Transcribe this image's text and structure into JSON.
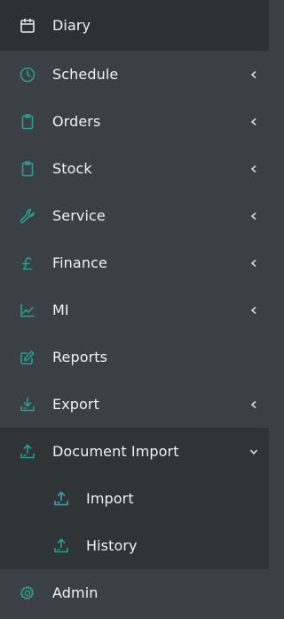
{
  "sidebar": {
    "items": [
      {
        "label": "Diary",
        "icon": "calendar-icon",
        "caret": "none"
      },
      {
        "label": "Schedule",
        "icon": "clock-icon",
        "caret": "left"
      },
      {
        "label": "Orders",
        "icon": "clipboard-icon",
        "caret": "left"
      },
      {
        "label": "Stock",
        "icon": "clipboard-icon",
        "caret": "left"
      },
      {
        "label": "Service",
        "icon": "wrench-icon",
        "caret": "left"
      },
      {
        "label": "Finance",
        "icon": "pound-icon",
        "caret": "left"
      },
      {
        "label": "MI",
        "icon": "chart-line-icon",
        "caret": "left"
      },
      {
        "label": "Reports",
        "icon": "edit-icon",
        "caret": "none"
      },
      {
        "label": "Export",
        "icon": "download-icon",
        "caret": "left"
      },
      {
        "label": "Document Import",
        "icon": "upload-icon",
        "caret": "down"
      }
    ],
    "subitems": [
      {
        "label": "Import",
        "icon": "upload-icon"
      },
      {
        "label": "History",
        "icon": "upload-icon"
      }
    ],
    "footer": {
      "label": "Admin",
      "icon": "gear-icon"
    }
  },
  "colors": {
    "background": "#3a4043",
    "active_background": "#2c3133",
    "submenu_background": "#2f3437",
    "accent_icon": "#2a9d8f",
    "sub_icon_accent": "#3aa0b8",
    "text": "#f2f2f2"
  }
}
